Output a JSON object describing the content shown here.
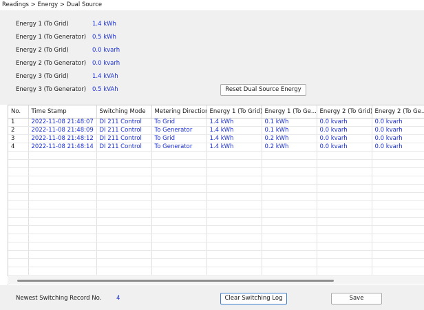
{
  "breadcrumb": "Readings > Energy > Dual Source",
  "summary": [
    {
      "label": "Energy 1 (To Grid)",
      "value": "1.4 kWh"
    },
    {
      "label": "Energy 1 (To Generator)",
      "value": "0.5 kWh"
    },
    {
      "label": "Energy 2 (To Grid)",
      "value": "0.0 kvarh"
    },
    {
      "label": "Energy 2 (To Generator)",
      "value": "0.0 kvarh"
    },
    {
      "label": "Energy 3 (To Grid)",
      "value": "1.4 kVAh"
    },
    {
      "label": "Energy 3 (To Generator)",
      "value": "0.5 kVAh"
    }
  ],
  "reset_button": "Reset Dual Source Energy",
  "table": {
    "columns": [
      "No.",
      "Time Stamp",
      "Switching Mode",
      "Metering Direction",
      "Energy 1 (To Grid)",
      "Energy 1 (To Ge...",
      "Energy 2 (To Grid)",
      "Energy 2 (To Ge..."
    ],
    "rows": [
      [
        "1",
        "2022-11-08 21:48:07",
        "DI 211 Control",
        "To Grid",
        "1.4 kWh",
        "0.1 kWh",
        "0.0 kvarh",
        "0.0 kvarh"
      ],
      [
        "2",
        "2022-11-08 21:48:09",
        "DI 211 Control",
        "To Generator",
        "1.4 kWh",
        "0.1 kWh",
        "0.0 kvarh",
        "0.0 kvarh"
      ],
      [
        "3",
        "2022-11-08 21:48:12",
        "DI 211 Control",
        "To Grid",
        "1.4 kWh",
        "0.2 kWh",
        "0.0 kvarh",
        "0.0 kvarh"
      ],
      [
        "4",
        "2022-11-08 21:48:14",
        "DI 211 Control",
        "To Generator",
        "1.4 kWh",
        "0.2 kWh",
        "0.0 kvarh",
        "0.0 kvarh"
      ]
    ]
  },
  "footer": {
    "newest_label": "Newest Switching Record No.",
    "newest_value": "4",
    "clear_button": "Clear Switching Log",
    "save_button": "Save"
  },
  "colors": {
    "value_text": "#1a2fd6",
    "panel_bg": "#f0f0f0",
    "focus_border": "#3c7fd1"
  }
}
